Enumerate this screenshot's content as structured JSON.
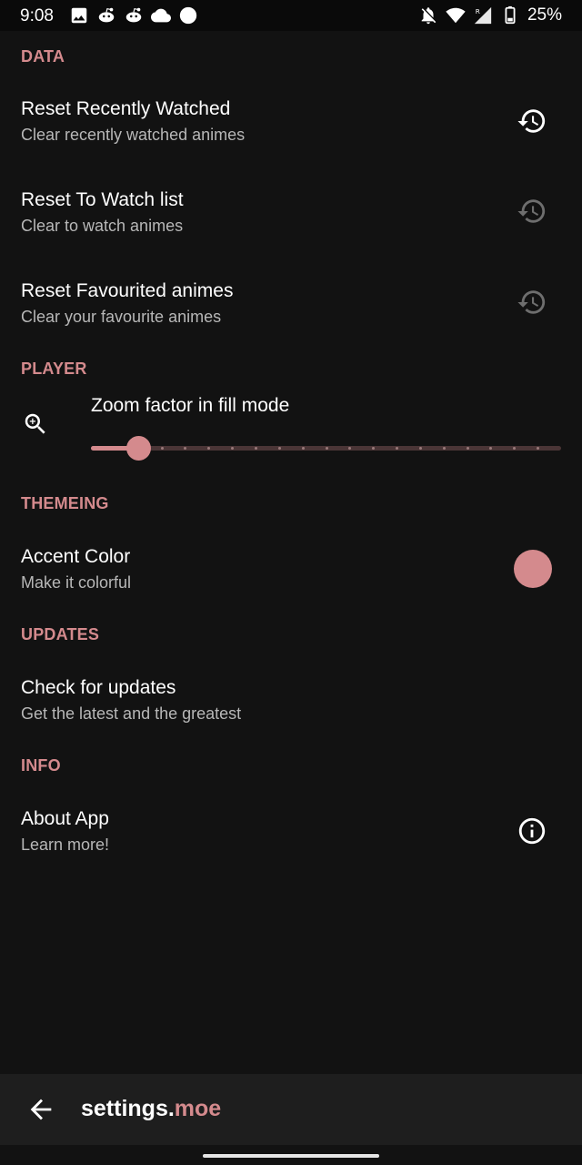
{
  "status_bar": {
    "time": "9:08",
    "battery": "25%",
    "left_icons": [
      "image-icon",
      "reddit-icon",
      "reddit-icon",
      "cloud-icon",
      "circle-icon"
    ],
    "right_icons": [
      "notifications-off-icon",
      "wifi-icon",
      "signal-roaming-icon",
      "battery-icon"
    ]
  },
  "sections": {
    "data": "DATA",
    "player": "PLAYER",
    "themeing": "THEMEING",
    "updates": "UPDATES",
    "info": "INFO"
  },
  "prefs": {
    "reset_recent": {
      "title": "Reset Recently Watched",
      "subtitle": "Clear recently watched animes",
      "icon": "history-icon"
    },
    "reset_watch": {
      "title": "Reset To Watch list",
      "subtitle": "Clear to watch animes",
      "icon": "history-icon"
    },
    "reset_fav": {
      "title": "Reset Favourited animes",
      "subtitle": "Clear your favourite animes",
      "icon": "history-icon"
    },
    "zoom": {
      "title": "Zoom factor in fill mode",
      "icon": "zoom-in-icon"
    },
    "accent": {
      "title": "Accent Color",
      "subtitle": "Make it colorful"
    },
    "updates": {
      "title": "Check for updates",
      "subtitle": "Get the latest and the greatest"
    },
    "about": {
      "title": "About App",
      "subtitle": "Learn more!",
      "icon": "info-icon"
    }
  },
  "zoom_slider": {
    "value": 0.1,
    "steps": 20
  },
  "colors": {
    "accent": "#d48a8d",
    "background": "#121212",
    "bar": "#1e1e1e"
  },
  "bottom_bar": {
    "title_main": "settings.",
    "title_accent": "moe",
    "back_icon": "arrow-back-icon"
  }
}
